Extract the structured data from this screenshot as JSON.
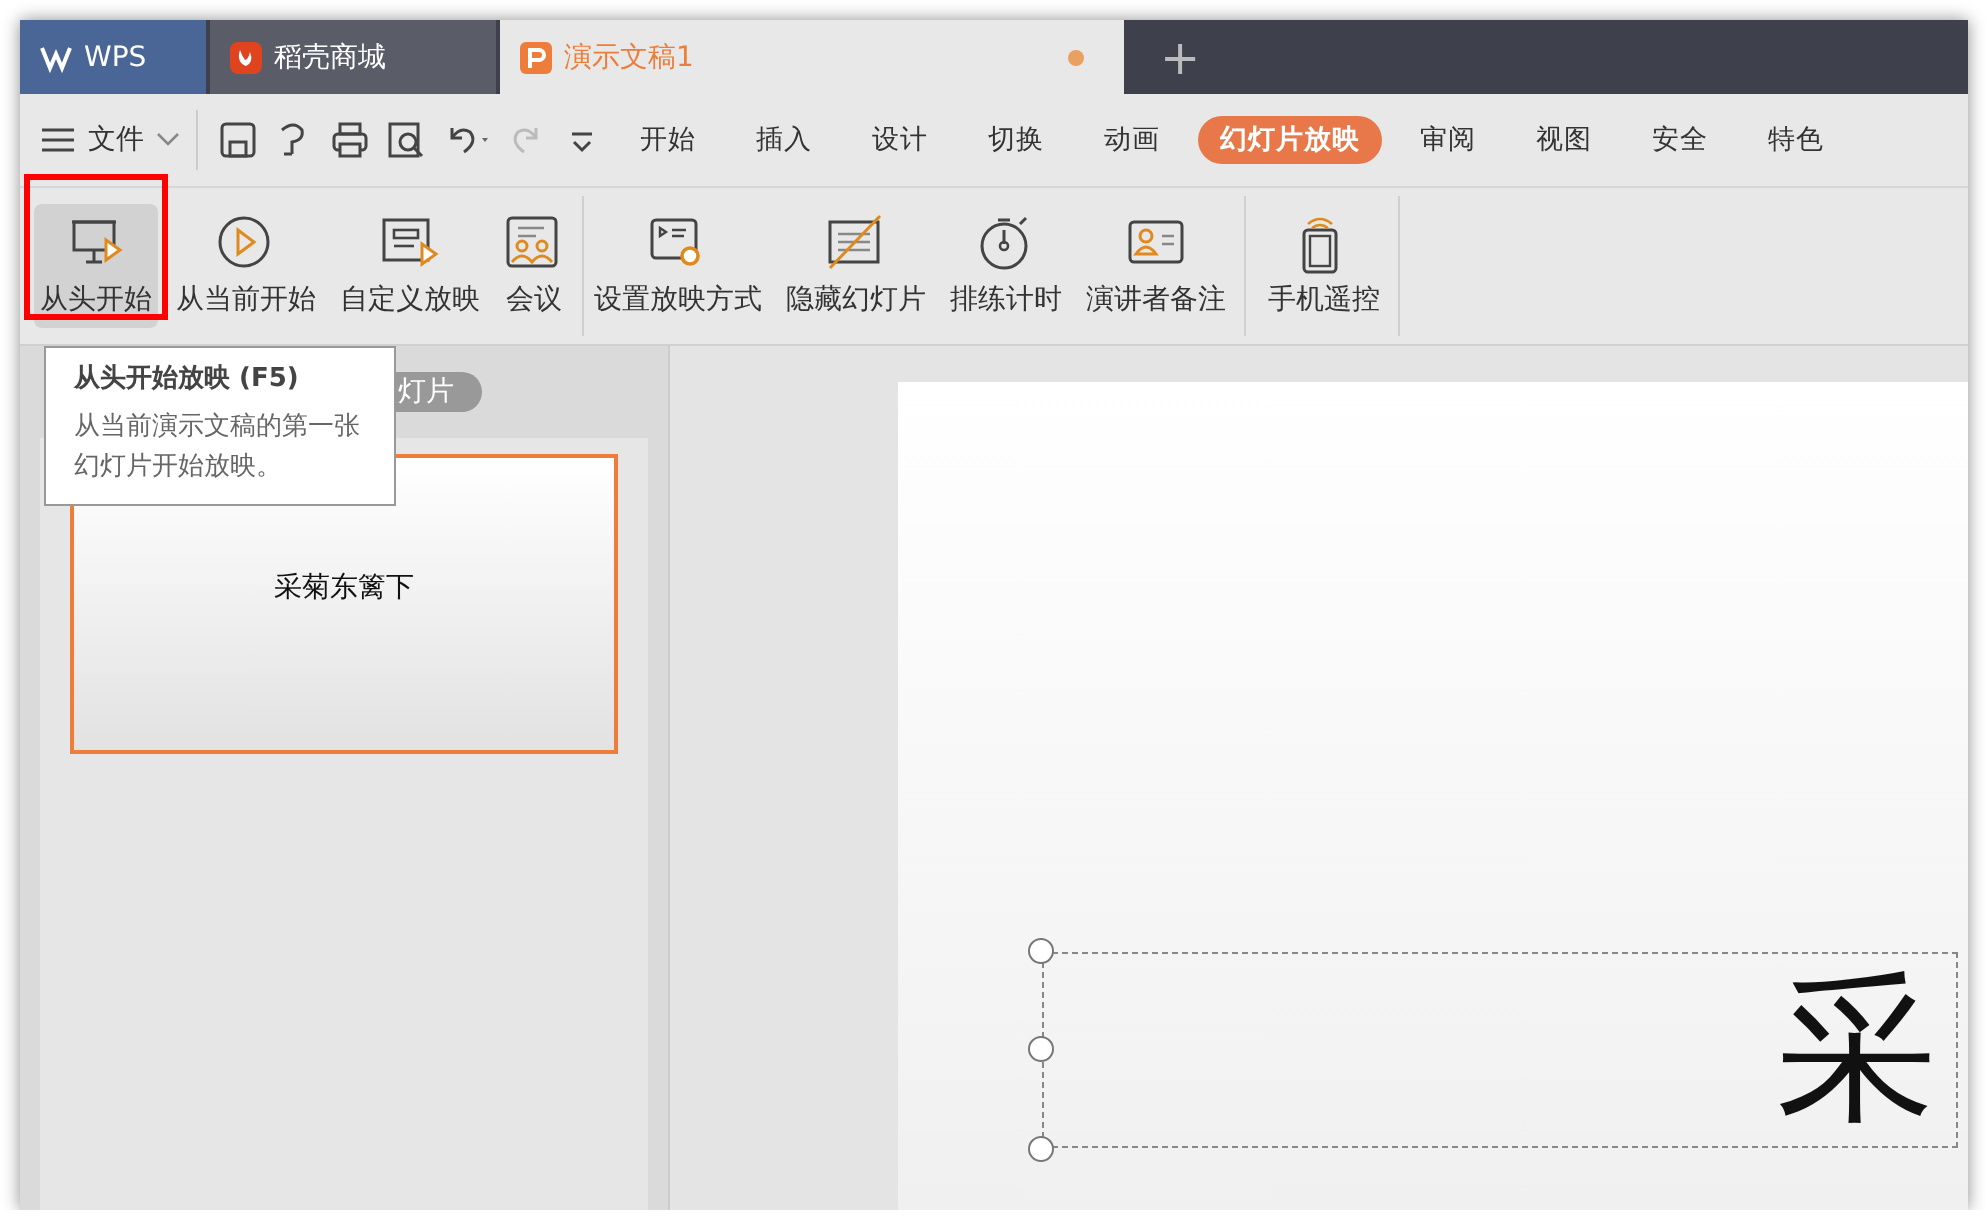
{
  "doc_tabs": [
    {
      "kind": "home",
      "label": "WPS",
      "selected": false
    },
    {
      "kind": "store",
      "label": "稻壳商城",
      "selected": false
    },
    {
      "kind": "doc",
      "label": "演示文稿1",
      "selected": true,
      "unsaved": true
    }
  ],
  "new_tab": "+",
  "menu": {
    "file": "文件",
    "tabs": [
      {
        "label": "开始",
        "selected": false
      },
      {
        "label": "插入",
        "selected": false
      },
      {
        "label": "设计",
        "selected": false
      },
      {
        "label": "切换",
        "selected": false
      },
      {
        "label": "动画",
        "selected": false
      },
      {
        "label": "幻灯片放映",
        "selected": true
      },
      {
        "label": "审阅",
        "selected": false
      },
      {
        "label": "视图",
        "selected": false
      },
      {
        "label": "安全",
        "selected": false
      },
      {
        "label": "特色",
        "selected": false
      }
    ]
  },
  "ribbon": [
    [
      {
        "kind": "from-start",
        "label": "从头开始",
        "hovered": true
      },
      {
        "kind": "from-current",
        "label": "从当前开始",
        "hovered": false
      },
      {
        "kind": "custom",
        "label": "自定义放映",
        "hovered": false
      },
      {
        "kind": "meeting",
        "label": "会议",
        "hovered": false
      }
    ],
    [
      {
        "kind": "setup",
        "label": "设置放映方式",
        "hovered": false
      },
      {
        "kind": "hide",
        "label": "隐藏幻灯片",
        "hovered": false
      },
      {
        "kind": "timer",
        "label": "排练计时",
        "hovered": false
      },
      {
        "kind": "notes",
        "label": "演讲者备注",
        "hovered": false
      }
    ],
    [
      {
        "kind": "remote",
        "label": "手机遥控",
        "hovered": false
      }
    ]
  ],
  "tooltip": {
    "title": "从头开始放映 (F5)",
    "text": "从当前演示文稿的第一张幻灯片开始放映。"
  },
  "panel": {
    "tab": "灯片",
    "slides": [
      {
        "title": "采菊东篱下",
        "selected": true
      }
    ]
  },
  "slide": {
    "text": "采"
  }
}
